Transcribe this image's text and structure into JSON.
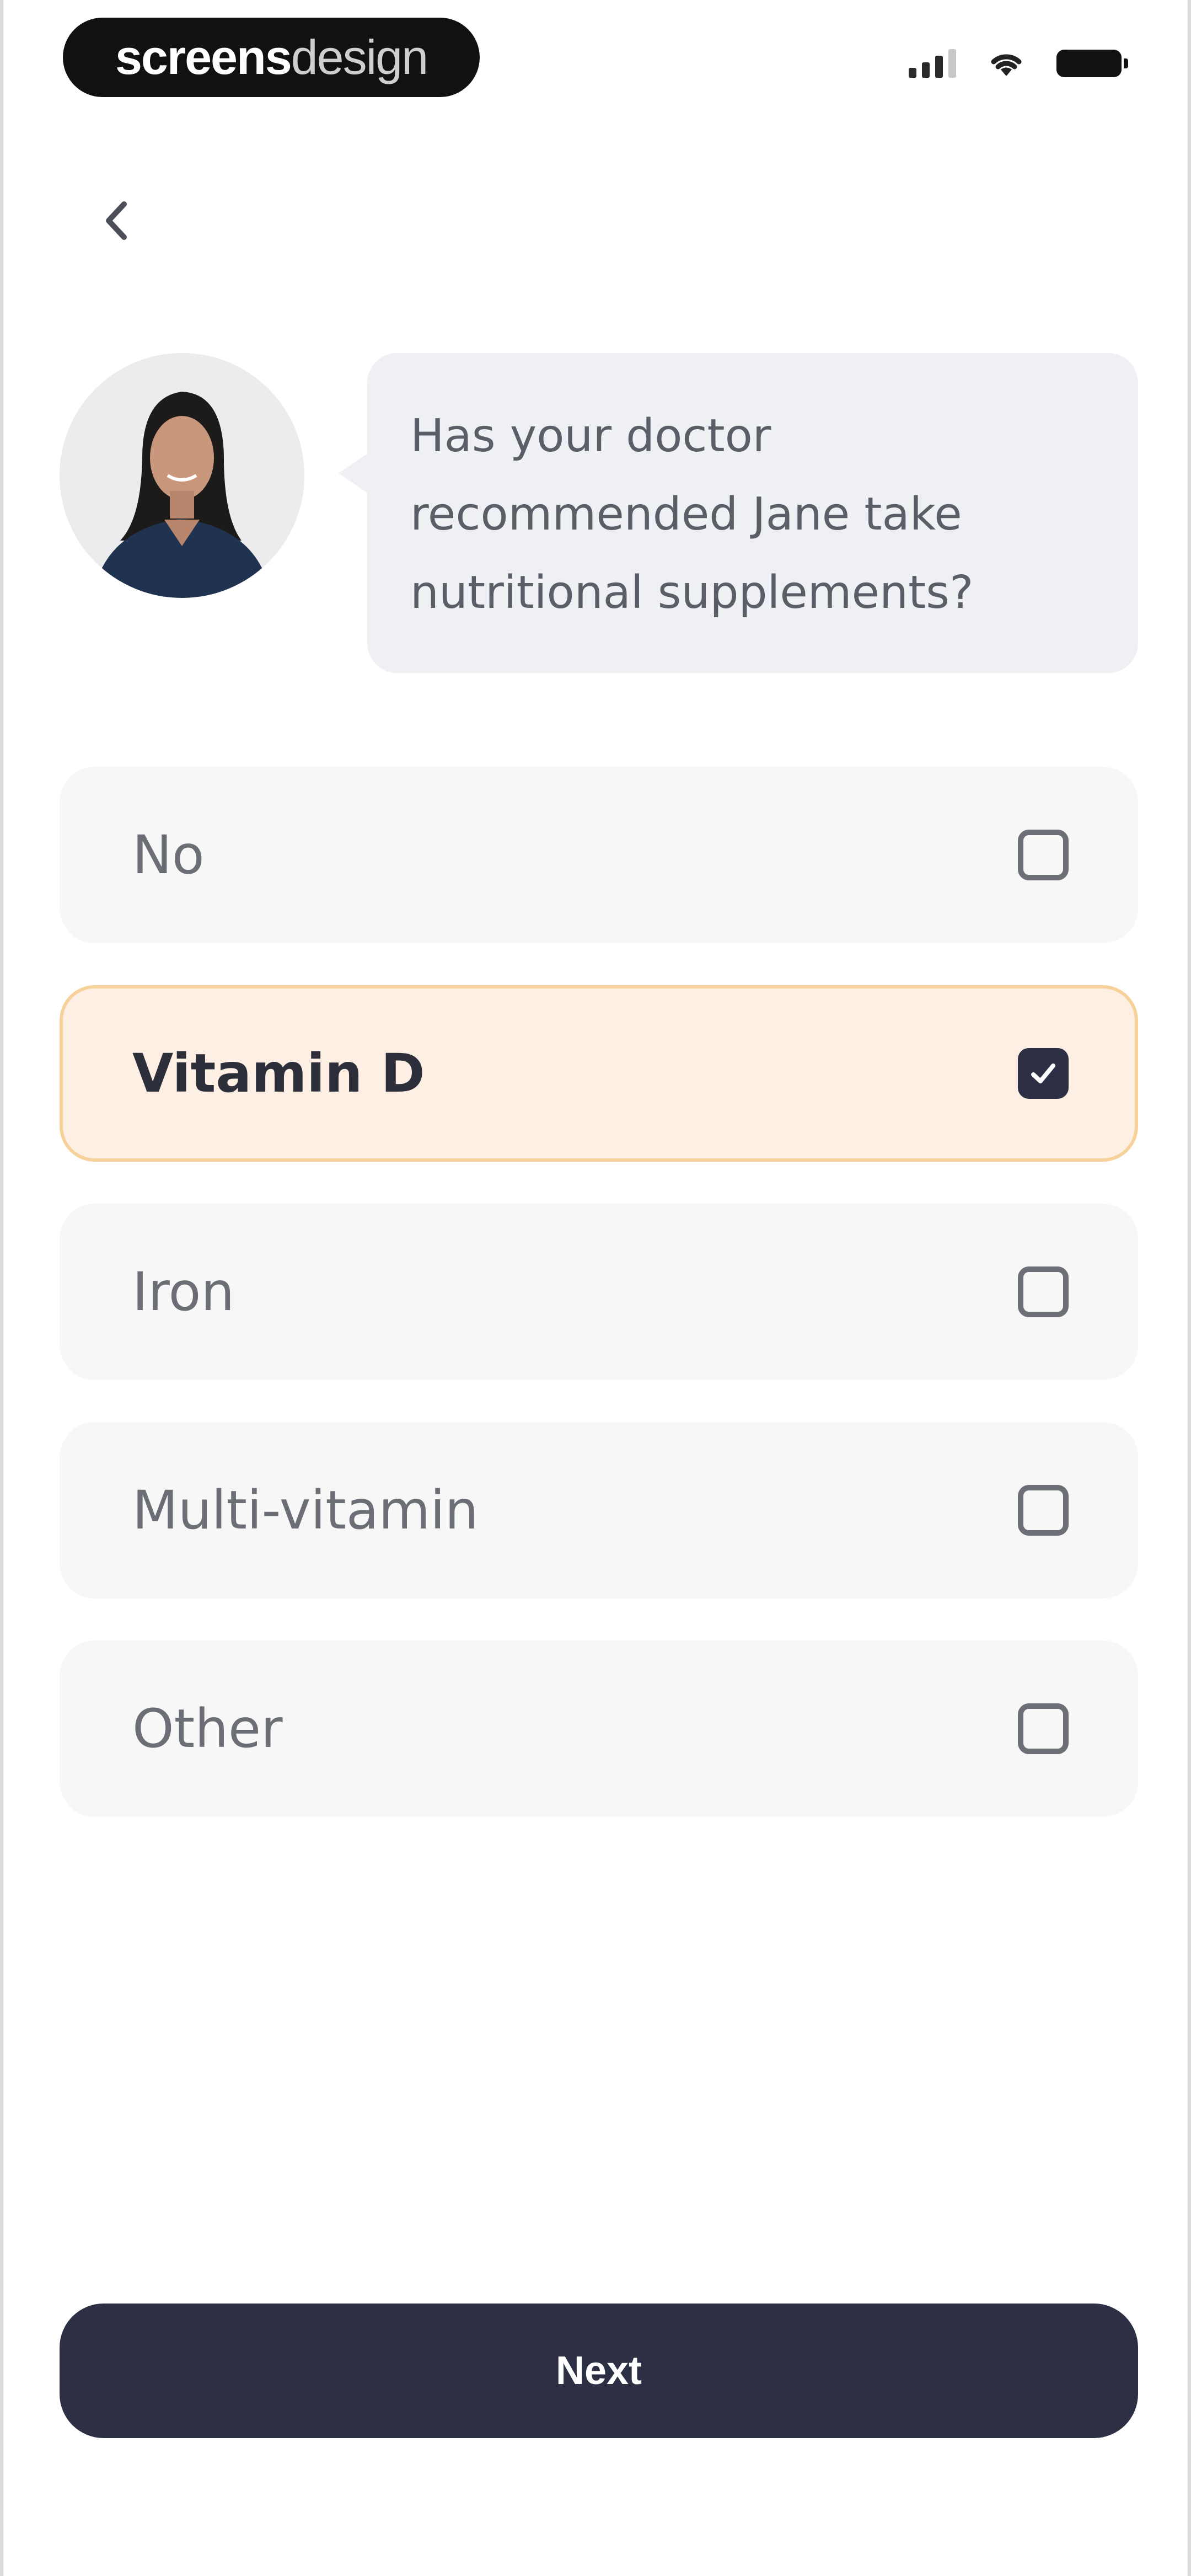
{
  "status_bar": {
    "brand_bold": "screens",
    "brand_light": "design"
  },
  "back": {
    "icon": "chevron-left-icon"
  },
  "assistant": {
    "message": "Has your doctor recommended Jane take nutritional supplements?"
  },
  "options": [
    {
      "label": "No",
      "checked": false
    },
    {
      "label": "Vitamin D",
      "checked": true
    },
    {
      "label": "Iron",
      "checked": false
    },
    {
      "label": "Multi-vitamin",
      "checked": false
    },
    {
      "label": "Other",
      "checked": false
    }
  ],
  "next_button": {
    "label": "Next"
  },
  "colors": {
    "primary": "#2d3045",
    "selected_bg": "#fdefe3",
    "selected_border": "#f6d29a",
    "option_bg": "#f7f7f8",
    "bubble_bg": "#eef0f4"
  }
}
